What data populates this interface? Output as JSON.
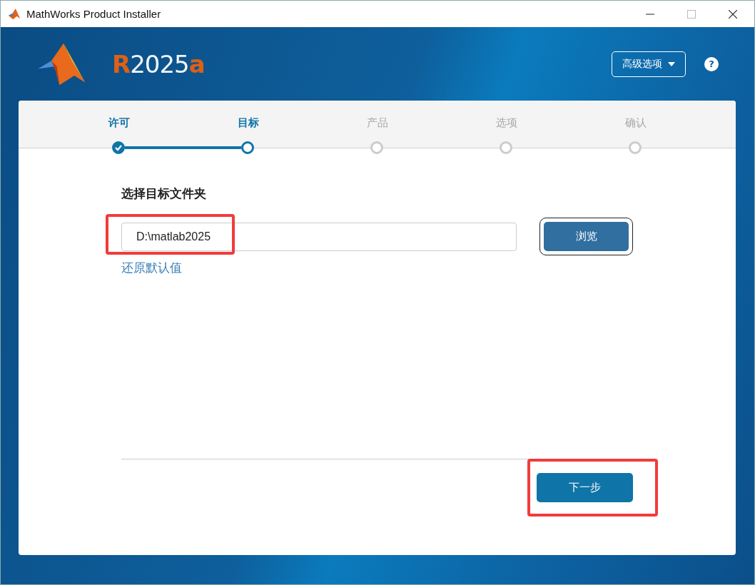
{
  "window": {
    "title": "MathWorks Product Installer"
  },
  "header": {
    "release": [
      {
        "text": "R",
        "kind": "accent"
      },
      {
        "text": "2025",
        "kind": "plain"
      },
      {
        "text": "a",
        "kind": "accent"
      }
    ],
    "advanced_button": "高级选项",
    "help": "?"
  },
  "steps": [
    {
      "label": "许可",
      "kind": "done"
    },
    {
      "label": "目标",
      "kind": "current"
    },
    {
      "label": "产品",
      "kind": "pending"
    },
    {
      "label": "选项",
      "kind": "pending"
    },
    {
      "label": "确认",
      "kind": "pending"
    }
  ],
  "destination": {
    "heading": "选择目标文件夹",
    "value": "D:\\matlab2025",
    "browse_button": "浏览",
    "restore_link": "还原默认值"
  },
  "next_button": "下一步"
}
